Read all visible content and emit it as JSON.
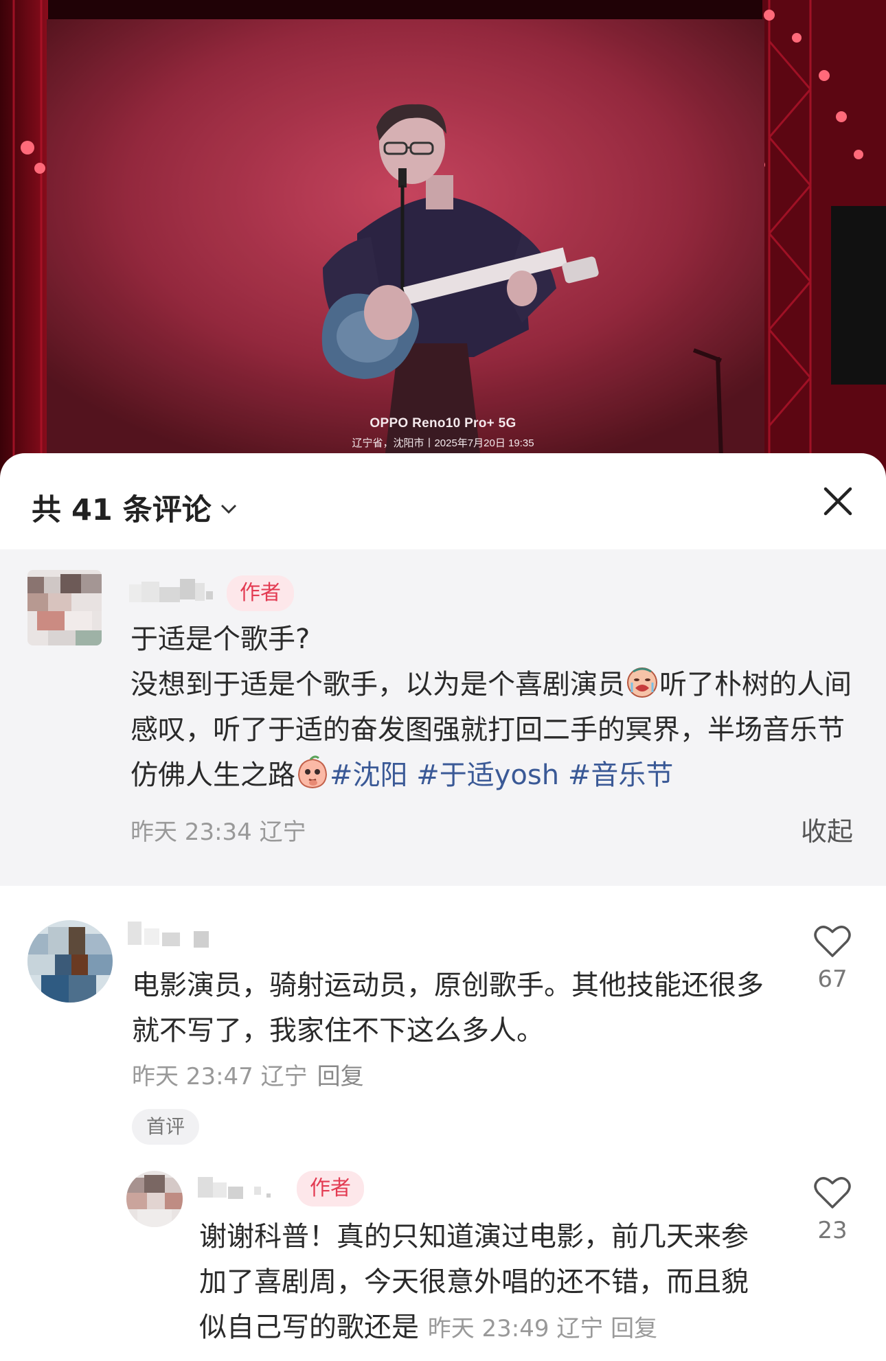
{
  "photo": {
    "watermark_brand": "OPPO Reno10 Pro+ 5G",
    "watermark_info": "辽宁省，沈阳市丨2025年7月20日 19:35"
  },
  "comments_panel": {
    "title": "共 41 条评论",
    "pinned_comment": {
      "badge": "作者",
      "title_line": "于适是个歌手?",
      "text_1": "没想到于适是个歌手，以为是个喜剧演员",
      "text_2": "听了朴树的人间感叹，听了于适的奋发图强就打回二手的冥界，半场音乐节仿佛人生之路",
      "tags": [
        "#沈阳",
        "#于适yosh",
        "#音乐节"
      ],
      "meta": "昨天 23:34 辽宁",
      "collapse_label": "收起"
    },
    "comment_1": {
      "text": "电影演员，骑射运动员，原创歌手。其他技能还很多就不写了，我家住不下这么多人。",
      "meta": "昨天 23:47 辽宁",
      "reply_label": "回复",
      "likes": "67",
      "first_badge": "首评"
    },
    "reply_1": {
      "badge": "作者",
      "text": "谢谢科普！真的只知道演过电影，前几天来参加了喜剧周，今天很意外唱的还不错，而且貌似自己写的歌还是",
      "meta": "昨天 23:49 辽宁",
      "reply_label": "回复",
      "likes": "23"
    }
  },
  "colors": {
    "accent_badge_text": "#e33b52",
    "accent_badge_bg": "#fde7ea",
    "hashtag": "#3a5996",
    "stage_red": "#c81a30"
  },
  "icons": [
    "chevron-down-icon",
    "close-icon",
    "heart-icon",
    "crying-emoji-icon",
    "peach-emoji-icon"
  ]
}
